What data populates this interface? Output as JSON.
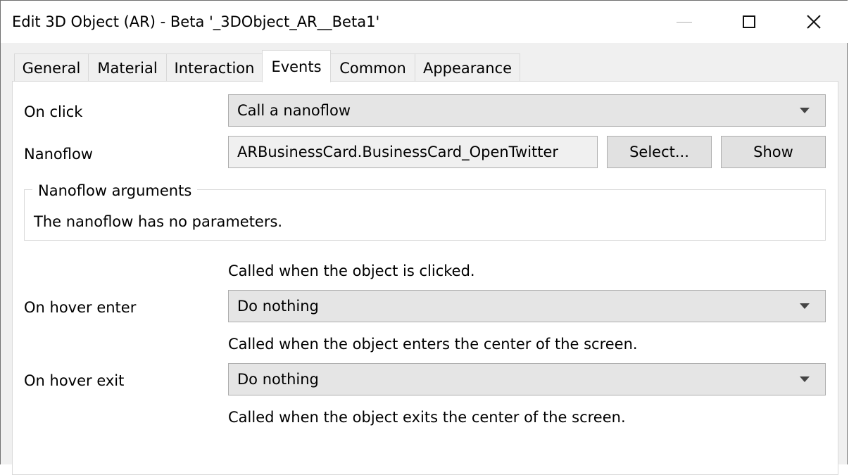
{
  "window": {
    "title": "Edit 3D Object (AR) - Beta '_3DObject_AR__Beta1'",
    "controls": [
      "minimize-icon",
      "maximize-icon",
      "close-icon"
    ],
    "close_glyph": "✕"
  },
  "tabs": [
    {
      "label": "General",
      "active": false
    },
    {
      "label": "Material",
      "active": false
    },
    {
      "label": "Interaction",
      "active": false
    },
    {
      "label": "Events",
      "active": true
    },
    {
      "label": "Common",
      "active": false
    },
    {
      "label": "Appearance",
      "active": false
    }
  ],
  "events": {
    "on_click": {
      "label": "On click",
      "value": "Call a nanoflow",
      "description": "Called when the object is clicked."
    },
    "nanoflow": {
      "label": "Nanoflow",
      "value": "ARBusinessCard.BusinessCard_OpenTwitter",
      "select_label": "Select...",
      "show_label": "Show"
    },
    "nanoflow_arguments": {
      "legend": "Nanoflow arguments",
      "message": "The nanoflow has no parameters."
    },
    "on_hover_enter": {
      "label": "On hover enter",
      "value": "Do nothing",
      "description": "Called when the object enters the center of the screen."
    },
    "on_hover_exit": {
      "label": "On hover exit",
      "value": "Do nothing",
      "description": "Called when the object exits the center of the screen."
    }
  }
}
